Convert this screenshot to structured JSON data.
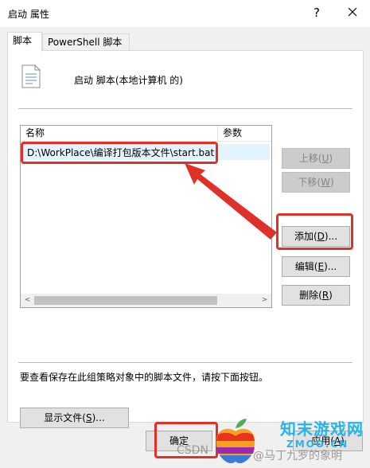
{
  "window": {
    "title": "启动 属性",
    "help_glyph": "?",
    "close_icon": "close-icon"
  },
  "tabs": [
    {
      "label": "脚本",
      "active": true
    },
    {
      "label": "PowerShell 脚本",
      "active": false
    }
  ],
  "panel": {
    "heading": "启动 脚本(本地计算机 的)",
    "list": {
      "columns": [
        "名称",
        "参数"
      ],
      "rows": [
        {
          "name": "D:\\WorkPlace\\编译打包版本文件\\start.bat",
          "params": ""
        }
      ],
      "scroll_left_glyph": "<",
      "scroll_right_glyph": ">"
    },
    "buttons": {
      "up": {
        "text": "上移(",
        "key": "U",
        "close": ")",
        "enabled": false
      },
      "down": {
        "text": "下移(",
        "key": "W",
        "close": ")",
        "enabled": false
      },
      "add": {
        "text": "添加(",
        "key": "D",
        "close": ")...",
        "enabled": true
      },
      "edit": {
        "text": "编辑(",
        "key": "E",
        "close": ")...",
        "enabled": true
      },
      "remove": {
        "text": "删除(",
        "key": "R",
        "close": ")",
        "enabled": true
      }
    },
    "info_text": "要查看保存在此组策略对象中的脚本文件，请按下面按钮。",
    "show_files": {
      "text": "显示文件(",
      "key": "S",
      "close": ")..."
    }
  },
  "footer": {
    "ok": "确定",
    "apply": {
      "text": "应用(",
      "key": "A",
      "close": ")"
    }
  },
  "annotation_color": "#e0302a",
  "watermark": {
    "brand": "知末游戏网",
    "url": "ZMOO.CN",
    "csdn": "CSDN",
    "author": "@马丁九罗的象明",
    "brand_color": "#28b3e8"
  }
}
